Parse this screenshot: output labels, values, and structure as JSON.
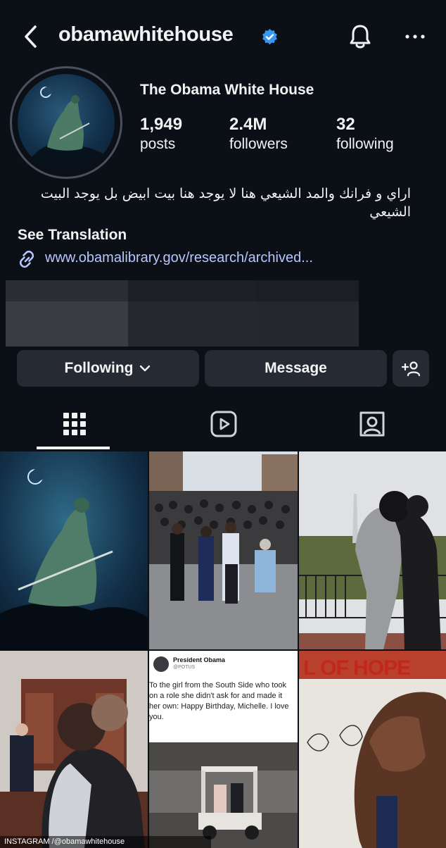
{
  "header": {
    "username": "obamawhitehouse",
    "back_icon": "chevron-left-icon",
    "verified_icon": "verified-badge-icon",
    "bell_icon": "bell-icon",
    "more_icon": "more-horizontal-icon",
    "verified_color": "#3897f0"
  },
  "profile": {
    "display_name": "The Obama White House",
    "stats": {
      "posts": {
        "value": "1,949",
        "label": "posts"
      },
      "followers": {
        "value": "2.4M",
        "label": "followers"
      },
      "following": {
        "value": "32",
        "label": "following"
      }
    },
    "bio": "اراي و فرانك والمد الشيعي هنا لا يوجد هنا بيت ابيض بل يوجد البيت الشيعي",
    "see_translation": "See Translation",
    "link_icon": "link-icon",
    "link": "www.obamalibrary.gov/research/archived...",
    "link_color": "#b8c6ff"
  },
  "actions": {
    "following_label": "Following",
    "following_icon": "chevron-down-icon",
    "message_label": "Message",
    "add_user_icon": "add-user-icon"
  },
  "tabs": [
    {
      "name": "posts-grid",
      "icon": "grid-icon",
      "active": true
    },
    {
      "name": "reels",
      "icon": "reels-icon",
      "active": false
    },
    {
      "name": "tagged",
      "icon": "tagged-user-icon",
      "active": false
    }
  ],
  "posts": [
    {
      "alt": "Artwork of a cloaked horseman with a sword under a crescent moon"
    },
    {
      "alt": "Crowd march with Barack and Michelle Obama at the front"
    },
    {
      "alt": "Couple embracing on a balcony overlooking the Washington Monument"
    },
    {
      "alt": "Michelle Obama hugging Barack Obama in an office"
    },
    {
      "alt": "Tweet screenshot and photo of the couple in a golf cart"
    },
    {
      "alt": "Mural of Martin Luther King Jr. being painted"
    }
  ],
  "tweet": {
    "author": "President Obama",
    "handle": "@POTUS",
    "text": "To the girl from the South Side who took on a role she didn't ask for and made it her own: Happy Birthday, Michelle. I love you."
  },
  "mural_text": "L OF HOPE",
  "footer_credit": "INSTAGRAM /@obamawhitehouse",
  "colors": {
    "background": "#0b0f16",
    "button": "#262a33",
    "text": "#f2f2f2"
  }
}
